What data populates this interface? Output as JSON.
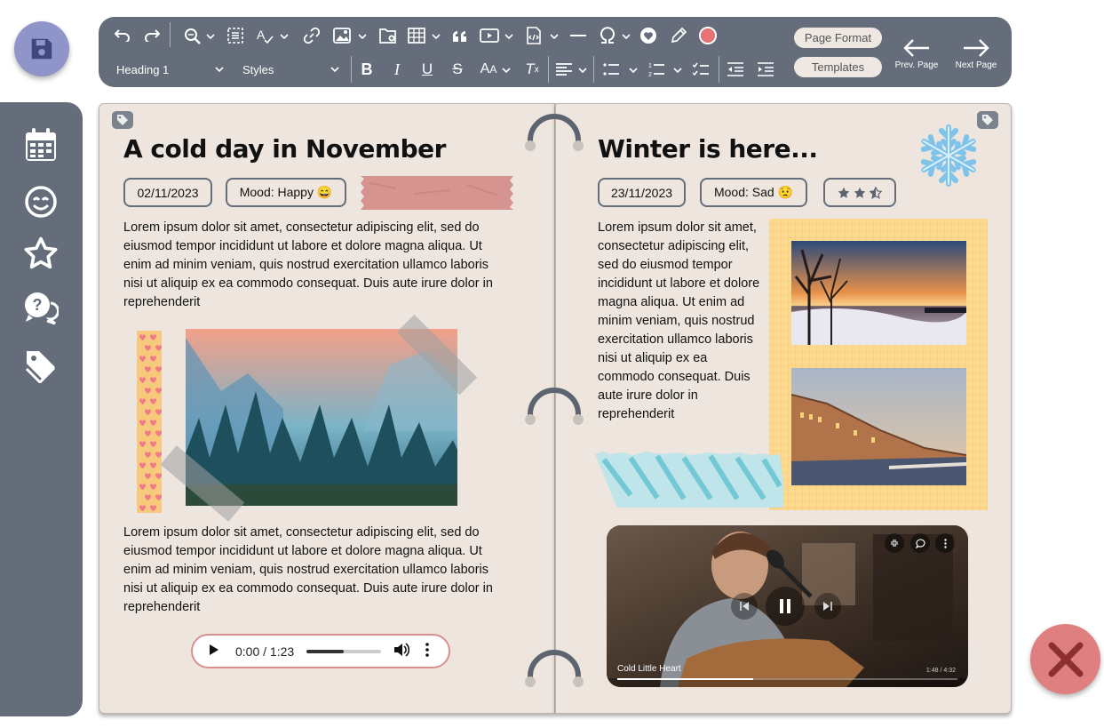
{
  "toolbar": {
    "heading_select": "Heading 1",
    "styles_select": "Styles",
    "page_format_label": "Page Format",
    "templates_label": "Templates",
    "prev_page_label": "Prev. Page",
    "next_page_label": "Next Page",
    "accent_color": "#e57373"
  },
  "left_page": {
    "title": "A cold day in November",
    "date": "02/11/2023",
    "mood": "Mood: Happy 😄",
    "paragraph1": "Lorem ipsum dolor sit amet, consectetur adipiscing elit, sed do eiusmod tempor incididunt ut labore et dolore magna aliqua. Ut enim ad minim veniam, quis nostrud exercitation ullamco laboris nisi ut aliquip ex ea commodo consequat. Duis aute irure dolor in reprehenderit",
    "paragraph2": "Lorem ipsum dolor sit amet, consectetur adipiscing elit, sed do eiusmod tempor incididunt ut labore et dolore magna aliqua. Ut enim ad minim veniam, quis nostrud exercitation ullamco laboris nisi ut aliquip ex ea commodo consequat. Duis aute irure dolor in reprehenderit",
    "audio_time": "0:00 / 1:23",
    "audio_progress": 0.5
  },
  "right_page": {
    "title": "Winter is here...",
    "date": "23/11/2023",
    "mood": "Mood: Sad 😟",
    "rating": 2.5,
    "rating_max": 3,
    "paragraph": "Lorem ipsum dolor sit amet, consectetur adipiscing elit, sed do eiusmod tempor incididunt ut labore et dolore magna aliqua. Ut enim ad minim veniam, quis nostrud exercitation ullamco laboris nisi ut aliquip ex ea commodo consequat. Duis aute irure dolor in reprehenderit",
    "video_title": "Cold Little Heart",
    "video_time": "1:48 / 4:32",
    "video_progress": 0.4
  }
}
